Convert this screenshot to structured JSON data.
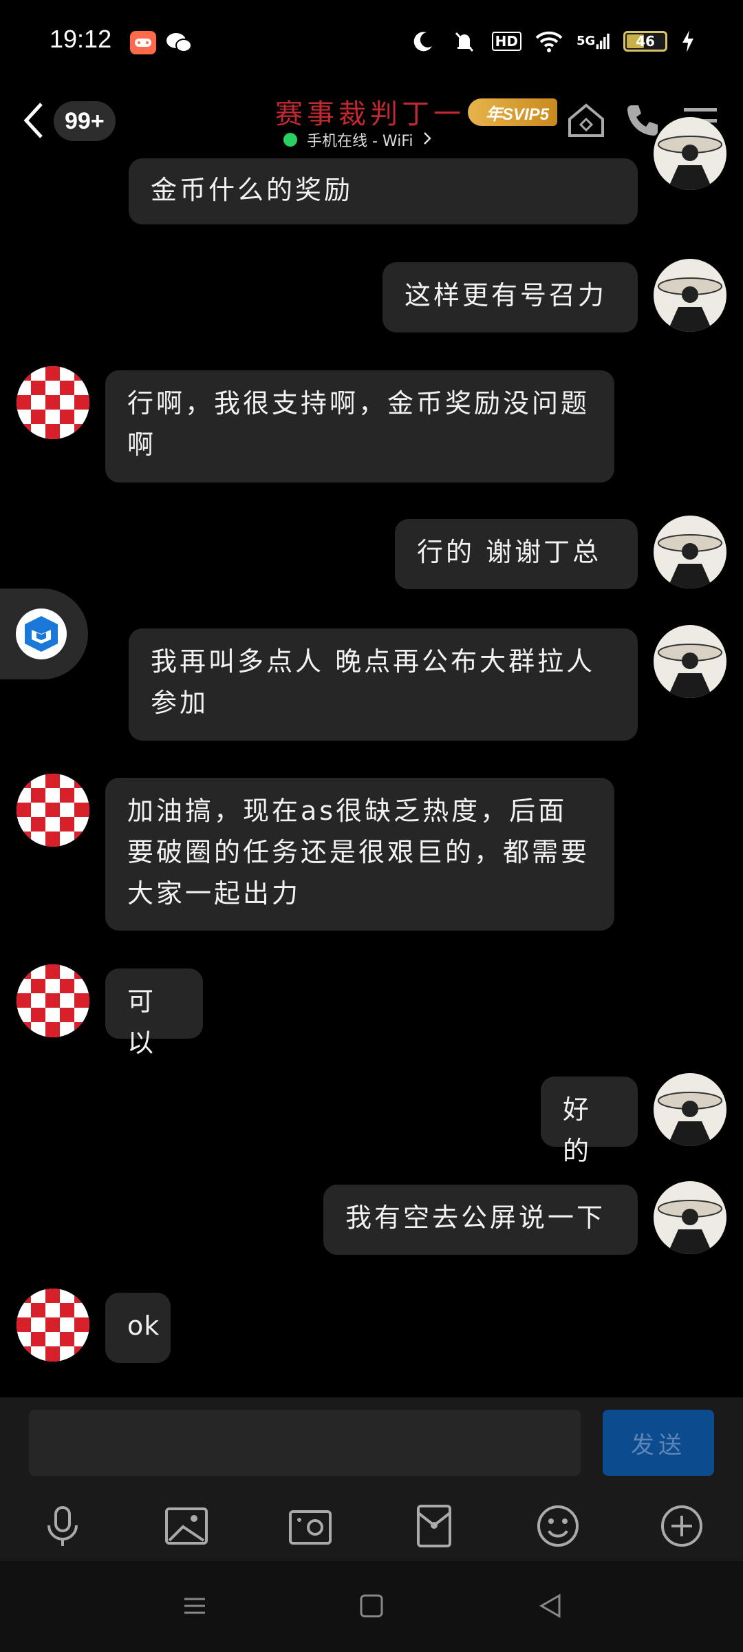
{
  "status_bar": {
    "time": "19:12",
    "hd": "HD",
    "network": "5G",
    "battery_level": "46",
    "battery_fraction": 0.46
  },
  "header": {
    "unread_count": "99+",
    "title": "赛事裁判丁一",
    "vip_badge": "年SVIP5",
    "online_status": "手机在线 - WiFi"
  },
  "messages": [
    {
      "side": "right",
      "text": "金币什么的奖励"
    },
    {
      "side": "right",
      "text": "这样更有号召力"
    },
    {
      "side": "left",
      "text": "行啊，我很支持啊，金币奖励没问题啊"
    },
    {
      "side": "right",
      "text": "行的  谢谢丁总"
    },
    {
      "side": "right",
      "text": "我再叫多点人 晚点再公布大群拉人参加"
    },
    {
      "side": "left",
      "text": "加油搞，现在as很缺乏热度，后面要破圈的任务还是很艰巨的，都需要大家一起出力"
    },
    {
      "side": "left",
      "text": "可以"
    },
    {
      "side": "right",
      "text": "好的"
    },
    {
      "side": "right",
      "text": "我有空去公屏说一下"
    },
    {
      "side": "left",
      "text": "ok"
    }
  ],
  "input": {
    "value": "",
    "send_label": "发送"
  },
  "toolbar_icons": [
    "microphone-icon",
    "image-icon",
    "camera-icon",
    "red-packet-icon",
    "emoji-icon",
    "plus-icon"
  ],
  "colors": {
    "background": "#000000",
    "bubble": "#262626",
    "title": "#c0292f",
    "online": "#2ad061",
    "send": "#0d4b8f"
  }
}
